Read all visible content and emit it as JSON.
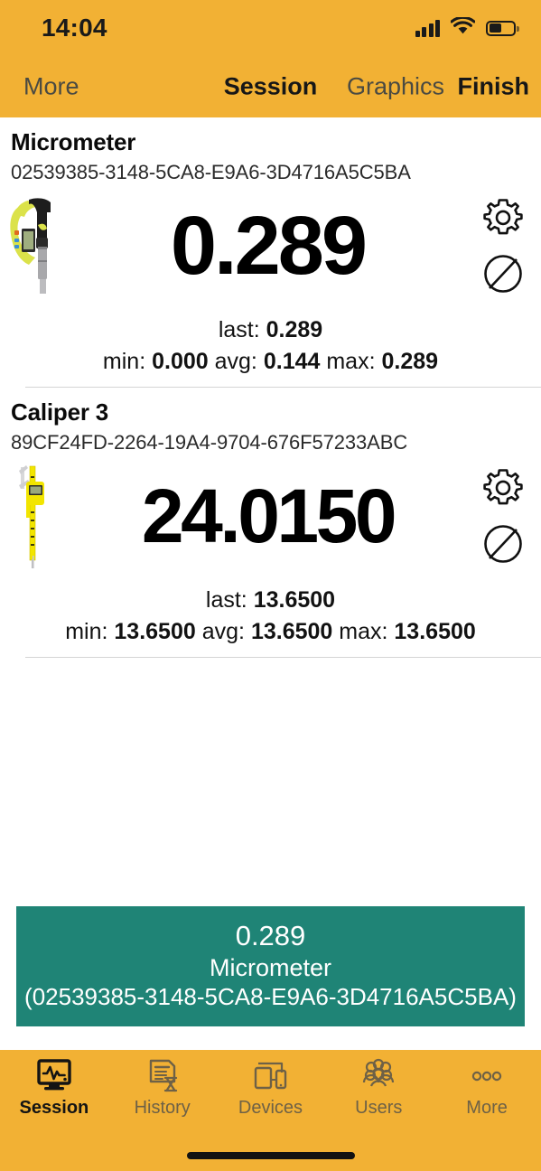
{
  "status_bar": {
    "time": "14:04",
    "signal_icon": "cellular-signal-icon",
    "wifi_icon": "wifi-icon",
    "battery_icon": "battery-icon",
    "battery_level_percent": 50
  },
  "nav_bar": {
    "back_label": "More",
    "title": "Session",
    "graphics_label": "Graphics",
    "finish_label": "Finish"
  },
  "theme": {
    "accent": "#f2b134",
    "banner_green": "#1f8476",
    "text_dark": "#0a0a0a",
    "tab_inactive": "#6e6146"
  },
  "devices": [
    {
      "name": "Micrometer",
      "uuid": "02539385-3148-5CA8-E9A6-3D4716A5C5BA",
      "thumbnail_icon": "micrometer-photo",
      "value": "0.289",
      "last_label": "last:",
      "last_value": "0.289",
      "min_label": "min:",
      "min_value": "0.000",
      "avg_label": "avg:",
      "avg_value": "0.144",
      "max_label": "max:",
      "max_value": "0.289",
      "settings_icon": "gear-icon",
      "diameter_icon": "diameter-icon"
    },
    {
      "name": "Caliper 3",
      "uuid": "89CF24FD-2264-19A4-9704-676F57233ABC",
      "thumbnail_icon": "caliper-photo",
      "value": "24.0150",
      "last_label": "last:",
      "last_value": "13.6500",
      "min_label": "min:",
      "min_value": "13.6500",
      "avg_label": "avg:",
      "avg_value": "13.6500",
      "max_label": "max:",
      "max_value": "13.6500",
      "settings_icon": "gear-icon",
      "diameter_icon": "diameter-icon"
    }
  ],
  "latest_reading": {
    "value": "0.289",
    "device_name": "Micrometer",
    "device_uuid": "(02539385-3148-5CA8-E9A6-3D4716A5C5BA)"
  },
  "tab_bar": {
    "items": [
      {
        "label": "Session",
        "icon": "monitor-pulse-icon",
        "active": true
      },
      {
        "label": "History",
        "icon": "document-hourglass-icon",
        "active": false
      },
      {
        "label": "Devices",
        "icon": "tablet-phone-icon",
        "active": false
      },
      {
        "label": "Users",
        "icon": "people-group-icon",
        "active": false
      },
      {
        "label": "More",
        "icon": "ellipsis-icon",
        "active": false
      }
    ]
  }
}
